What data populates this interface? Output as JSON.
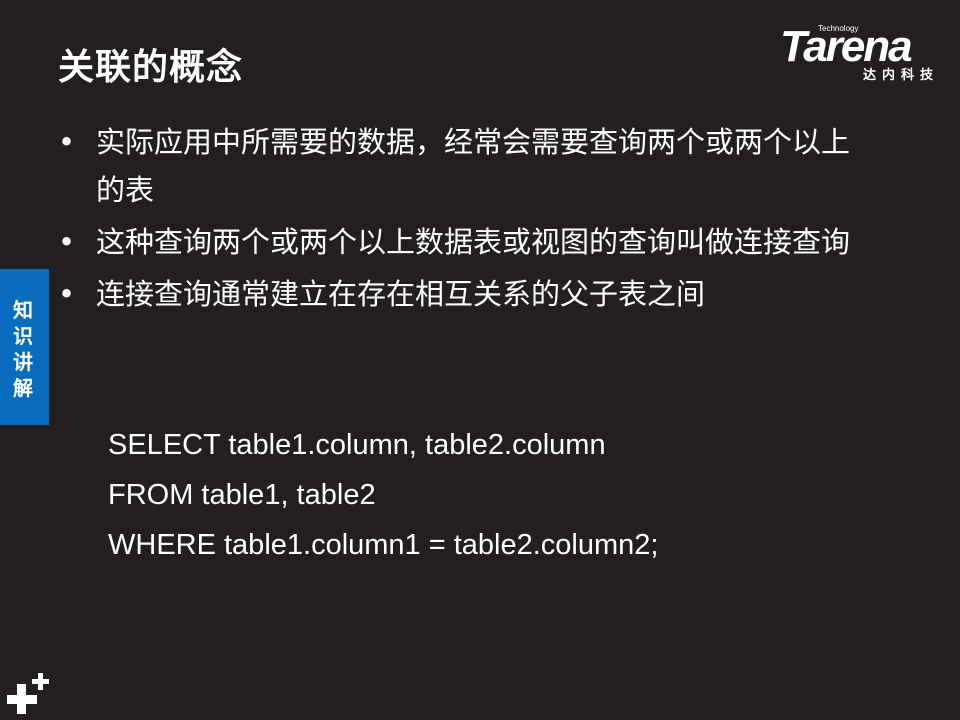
{
  "slide": {
    "title": "关联的概念",
    "logo": {
      "tagline": "Technology",
      "brand": "Tarena",
      "chinese": "达内科技"
    },
    "side_tab": "知识讲解",
    "bullets": [
      "实际应用中所需要的数据，经常会需要查询两个或两个以上的表",
      "这种查询两个或两个以上数据表或视图的查询叫做连接查询",
      "连接查询通常建立在存在相互关系的父子表之间"
    ],
    "code_lines": [
      "SELECT table1.column, table2.column",
      "FROM table1, table2",
      "WHERE table1.column1 = table2.column2;"
    ],
    "colors": {
      "background": "#231f20",
      "tab": "#0a6cbf",
      "text": "#ffffff"
    }
  }
}
